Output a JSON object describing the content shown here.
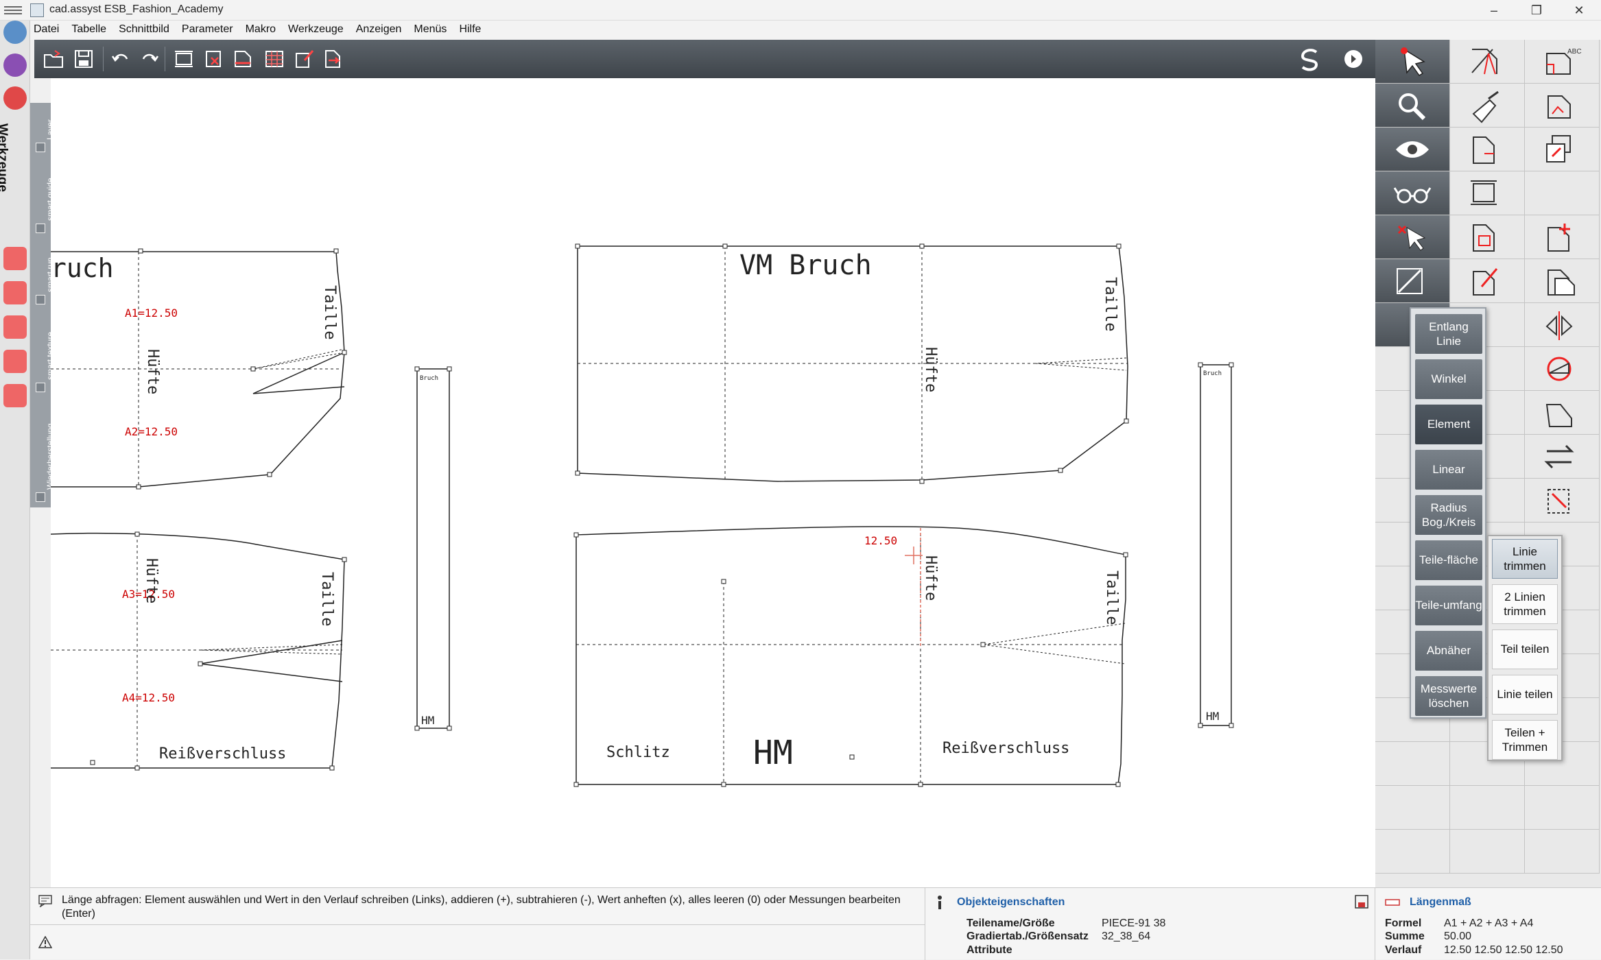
{
  "window": {
    "title": "cad.assyst  ESB_Fashion_Academy",
    "minimize": "–",
    "maximize": "❐",
    "close": "✕"
  },
  "menu": [
    "Datei",
    "Tabelle",
    "Schnittbild",
    "Parameter",
    "Makro",
    "Werkzeuge",
    "Anzeigen",
    "Menüs",
    "Hilfe"
  ],
  "left_panel": {
    "title": "Werkzeuge",
    "tabs": [
      "Layer",
      "smart guide",
      "smart run",
      "smart texture",
      "Wiederherstellung"
    ]
  },
  "canvas": {
    "piece_left_top": {
      "title": "ruch",
      "a1": "A1=12.50",
      "a2": "A2=12.50",
      "huefte": "Hüfte",
      "taille": "Taille"
    },
    "piece_left_bottom": {
      "a3": "A3=12.50",
      "a4": "A4=12.50",
      "huefte": "Hüfte",
      "taille": "Taille",
      "reissverschluss": "Reißverschluss"
    },
    "strip_left": {
      "top": "Bruch",
      "hm": "HM"
    },
    "piece_main_top": {
      "title": "VM Bruch",
      "huefte": "Hüfte",
      "taille": "Taille"
    },
    "piece_main_bottom": {
      "measure": "12.50",
      "huefte": "Hüfte",
      "taille": "Taille",
      "schlitz": "Schlitz",
      "hm": "HM",
      "reissverschluss": "Reißverschluss"
    },
    "strip_right": {
      "top": "Bruch",
      "hm": "HM"
    }
  },
  "measure_popup": [
    "Entlang Linie",
    "Winkel",
    "Element",
    "Linear",
    "Radius Bog./Kreis",
    "Teile-fläche",
    "Teile-umfang",
    "Abnäher",
    "Messwerte löschen"
  ],
  "measure_popup_selected": "Element",
  "trim_popup": [
    "Linie trimmen",
    "2 Linien trimmen",
    "Teil teilen",
    "Linie teilen",
    "Teilen + Trimmen"
  ],
  "trim_popup_selected": "Linie trimmen",
  "status": {
    "hint": "Länge abfragen: Element auswählen und Wert in den Verlauf schreiben (Links), addieren (+), subtrahieren (-), Wert anheften (x), alles leeren (0) oder Messungen bearbeiten (Enter)"
  },
  "object_properties": {
    "title": "Objekteigenschaften",
    "teilename_label": "Teilename/Größe",
    "teilename_value": "PIECE-91 38",
    "gradiertab_label": "Gradiertab./Größensatz",
    "gradiertab_value": "32_38_64",
    "attribute_label": "Attribute"
  },
  "laengenmass": {
    "title": "Längenmaß",
    "formel_label": "Formel",
    "formel_value": "A1 + A2 + A3 + A4",
    "summe_label": "Summe",
    "summe_value": "50.00",
    "verlauf_label": "Verlauf",
    "verlauf_value": "12.50 12.50 12.50 12.50"
  },
  "colors": {
    "toolbar": "#4a5057",
    "panel_dark": "#5c636a",
    "measure_red": "#cc0000",
    "accent_blue": "#1f5fa8"
  }
}
